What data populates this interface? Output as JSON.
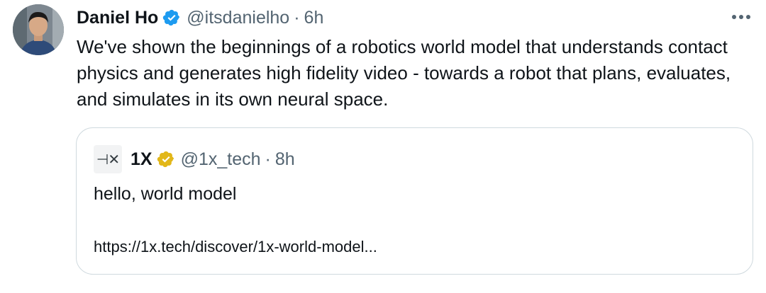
{
  "author": {
    "name": "Daniel Ho",
    "handle": "@itsdanielho",
    "separator": "·",
    "time": "6h",
    "verified_icon": "verified-blue-badge-icon"
  },
  "tweet_text": "We've shown the beginnings of a robotics world model that understands contact physics and generates high fidelity video - towards a robot that plans, evaluates, and simulates in its own neural space.",
  "quoted": {
    "logo_text": "1X",
    "name": "1X",
    "handle": "@1x_tech",
    "separator": "·",
    "time": "8h",
    "verified_icon": "verified-gold-badge-icon",
    "text": "hello, world model",
    "link": "https://1x.tech/discover/1x-world-model..."
  },
  "colors": {
    "text_primary": "#0f1419",
    "text_secondary": "#536471",
    "verified_blue": "#1d9bf0",
    "verified_gold": "#e2b719",
    "border": "#cfd9de"
  },
  "icons": {
    "more": "more-horizontal-icon"
  }
}
